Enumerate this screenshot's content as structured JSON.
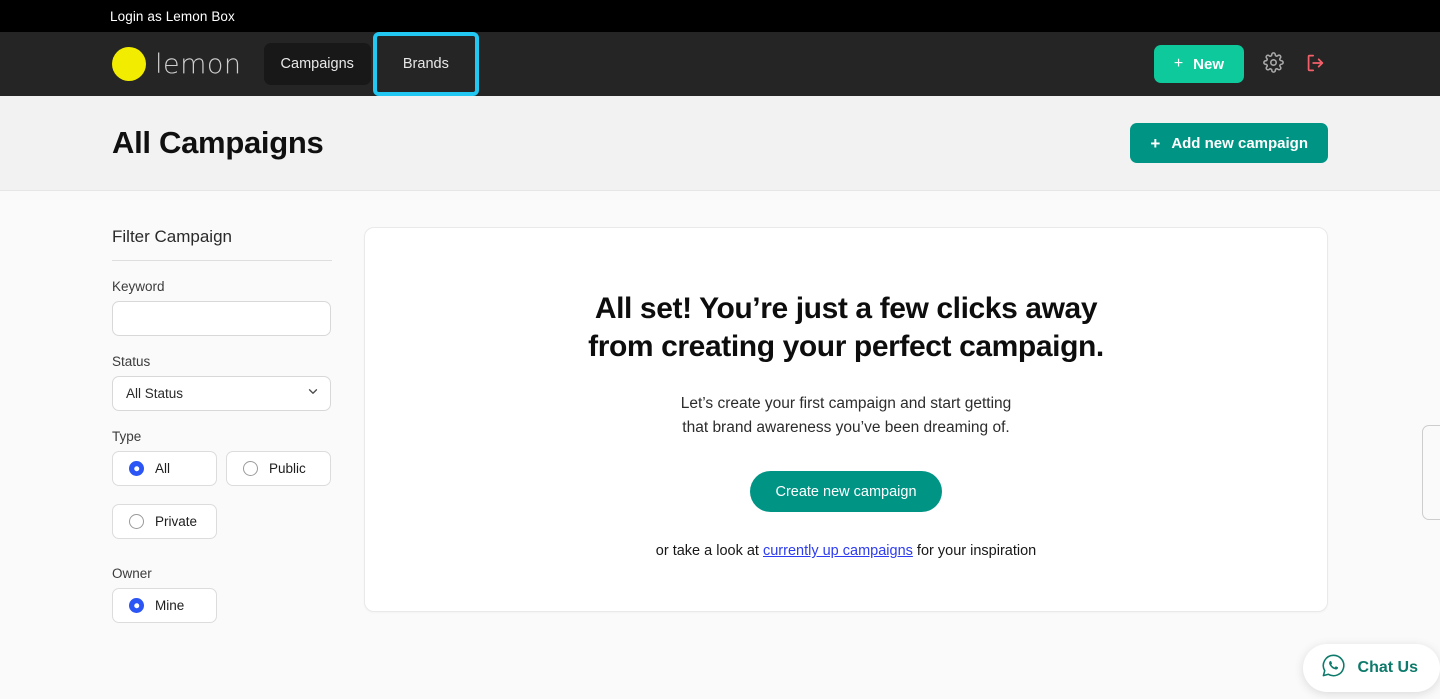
{
  "login_strip": {
    "text": "Login as Lemon Box"
  },
  "navbar": {
    "logo_word": "lemon",
    "tabs": [
      {
        "label": "Campaigns",
        "state": "pill"
      },
      {
        "label": "Brands",
        "state": "highlighted"
      }
    ],
    "new_button": {
      "label": "New",
      "plus": "+"
    },
    "settings_icon": "gear-icon",
    "logout_icon": "logout-icon",
    "colors": {
      "strip_bg": "#000000",
      "nav_bg": "#252525",
      "logo_dot": "#f2ec00",
      "new_button_bg": "#0ec99b",
      "highlight": "#22c7f2",
      "logout": "#f4606a"
    }
  },
  "page_header": {
    "title": "All Campaigns",
    "add_button": {
      "label": "Add new campaign",
      "plus": "+"
    }
  },
  "filter": {
    "title": "Filter Campaign",
    "keyword": {
      "label": "Keyword",
      "value": "",
      "placeholder": ""
    },
    "status": {
      "label": "Status",
      "selected": "All Status"
    },
    "type": {
      "label": "Type",
      "options": [
        {
          "label": "All",
          "checked": true
        },
        {
          "label": "Public",
          "checked": false
        },
        {
          "label": "Private",
          "checked": false
        }
      ]
    },
    "owner": {
      "label": "Owner",
      "options": [
        {
          "label": "Mine",
          "checked": true
        }
      ]
    }
  },
  "main_card": {
    "headline_line1": "All set! You’re just a few clicks away",
    "headline_line2": "from creating your perfect campaign.",
    "sub_line1": "Let’s create your first campaign and start getting",
    "sub_line2": "that brand awareness you’ve been dreaming of.",
    "create_button": "Create new campaign",
    "footer_prefix": "or take a look at ",
    "footer_link": "currently up campaigns",
    "footer_suffix": " for your inspiration"
  },
  "chat_widget": {
    "label": "Chat Us",
    "icon": "whatsapp-icon",
    "color": "#0d7a6b"
  }
}
